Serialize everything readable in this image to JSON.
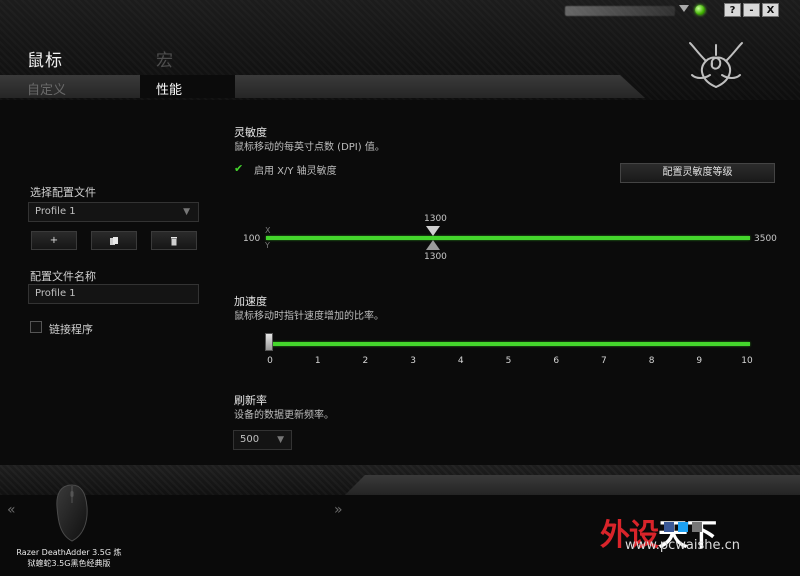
{
  "window": {
    "user_account": "",
    "buttons": {
      "help": "?",
      "minimize": "-",
      "close": "X"
    }
  },
  "tabs": {
    "main": [
      {
        "label": "鼠标",
        "active": true
      },
      {
        "label": "宏",
        "active": false
      }
    ],
    "sub": [
      {
        "label": "自定义",
        "active": false
      },
      {
        "label": "性能",
        "active": true
      }
    ]
  },
  "sidebar": {
    "profile_select_label": "选择配置文件",
    "profile_selected": "Profile 1",
    "profile_buttons": {
      "add": "+",
      "copy_icon": "copy-icon",
      "delete_icon": "trash-icon"
    },
    "profile_name_label": "配置文件名称",
    "profile_name_value": "Profile 1",
    "link_program_label": "链接程序",
    "link_program_checked": false
  },
  "sensitivity": {
    "title": "灵敏度",
    "description": "鼠标移动的每英寸点数 (DPI) 值。",
    "enable_xy_label": "启用 X/Y 轴灵敏度",
    "enable_xy_checked": true,
    "config_button": "配置灵敏度等级",
    "min": "100",
    "max": "3500",
    "x_value": "1300",
    "y_value": "1300",
    "x_axis_label": "X",
    "y_axis_label": "Y",
    "value_fraction": 0.353
  },
  "acceleration": {
    "title": "加速度",
    "description": "鼠标移动时指针速度增加的比率。",
    "value": 0,
    "ticks": [
      "0",
      "1",
      "2",
      "3",
      "4",
      "5",
      "6",
      "7",
      "8",
      "9",
      "10"
    ]
  },
  "polling": {
    "title": "刷新率",
    "description": "设备的数据更新频率。",
    "selected": "500"
  },
  "footer": {
    "device_name_line1": "Razer DeathAdder 3.5G 炼",
    "device_name_line2": "狱蝰蛇3.5G黑色经典版",
    "prev": "«",
    "next": "»",
    "watermark": {
      "part1": "外设",
      "part2": "天下",
      "url": "www.pcwaishe.cn"
    }
  },
  "colors": {
    "accent": "#44d62c",
    "watermark_red": "#d9242a"
  }
}
